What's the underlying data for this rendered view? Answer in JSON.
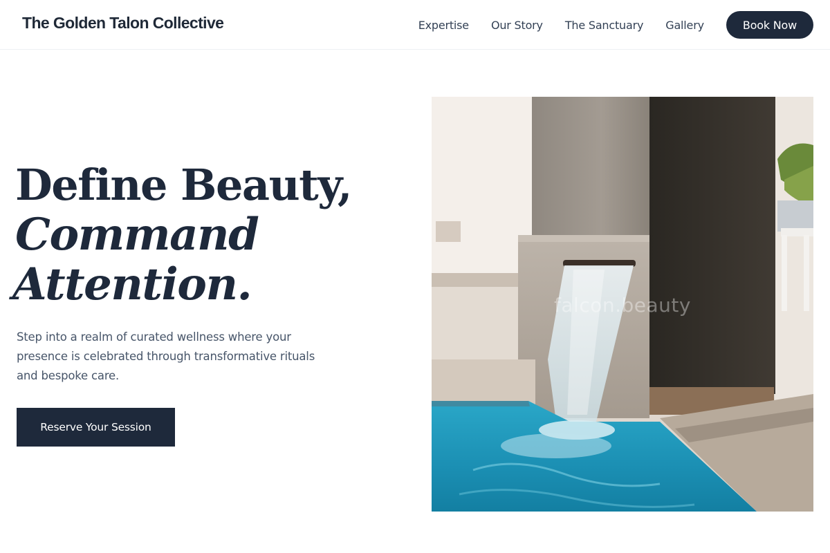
{
  "header": {
    "brand": "The Golden Talon Collective",
    "nav": [
      "Expertise",
      "Our Story",
      "The Sanctuary",
      "Gallery"
    ],
    "book_button": "Book Now"
  },
  "hero": {
    "title_line1": "Define Beauty,",
    "title_line2": "Command",
    "title_line3": "Attention.",
    "description": "Step into a realm of curated wellness where your presence is celebrated through transformative rituals and bespoke care.",
    "cta": "Reserve Your Session",
    "image_watermark": "falcon.beauty"
  },
  "colors": {
    "primary": "#1e293b",
    "text_muted": "#475569",
    "background": "#ffffff",
    "pool": "#1c9bbf"
  }
}
